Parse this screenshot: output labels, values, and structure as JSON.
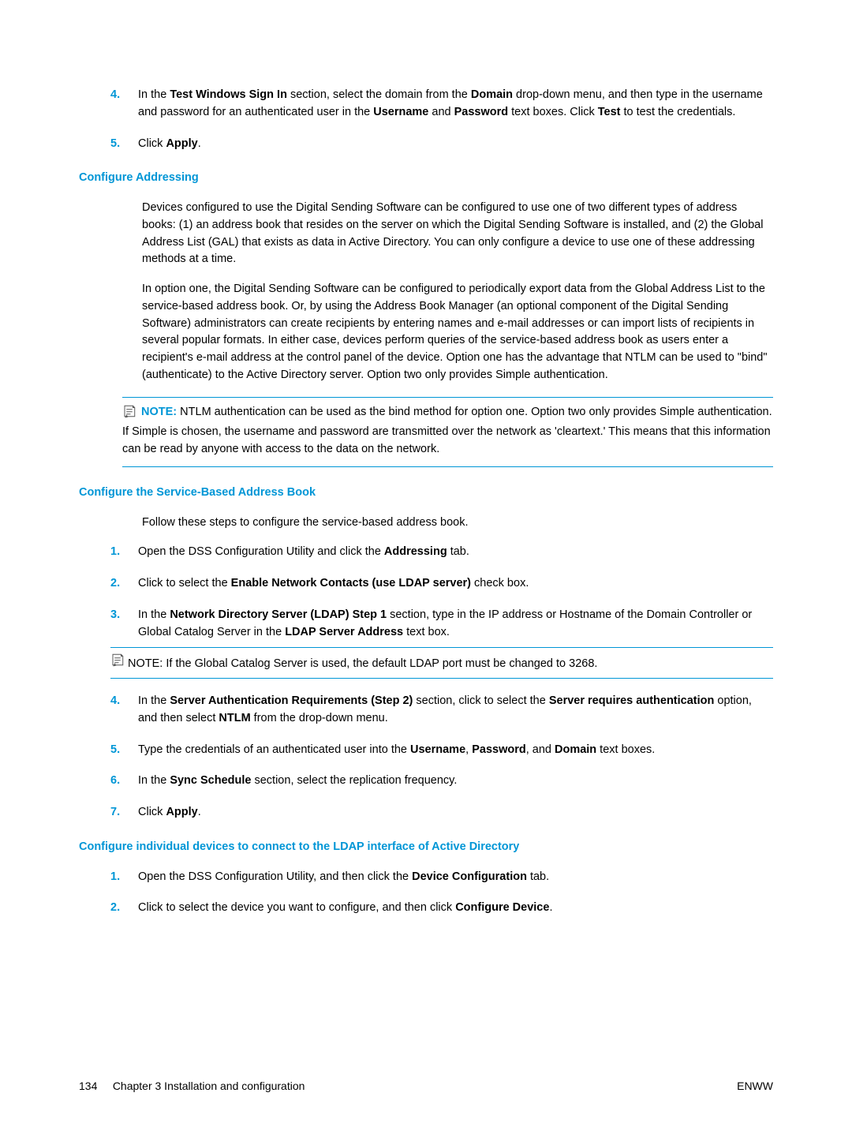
{
  "step4": {
    "num": "4.",
    "text_a": "In the ",
    "b1": "Test Windows Sign In",
    "text_b": " section, select the domain from the ",
    "b2": "Domain",
    "text_c": " drop-down menu, and then type in the username and password for an authenticated user in the ",
    "b3": "Username",
    "text_d": " and ",
    "b4": "Password",
    "text_e": " text boxes. Click ",
    "b5": "Test",
    "text_f": " to test the credentials."
  },
  "step5": {
    "num": "5.",
    "text_a": "Click ",
    "b1": "Apply",
    "text_b": "."
  },
  "h_addr": "Configure Addressing",
  "p_addr1": "Devices configured to use the Digital Sending Software can be configured to use one of two different types of address books: (1) an address book that resides on the server on which the Digital Sending Software is installed, and (2) the Global Address List (GAL) that exists as data in Active Directory. You can only configure a device to use one of these address­ing methods at a time.",
  "p_addr2": "In option one, the Digital Sending Software can be configured to periodically export data from the Global Address List to the service-based address book. Or, by using the Address Book Manager (an optional component of the Digital Sending Software) administrators can create recipients by entering names and e-mail addresses or can import lists of recipients in several popular formats. In either case, devices perform queries of the service-based address book as users enter a recipient's e-mail address at the control panel of the device. Option one has the advantage that NTLM can be used to \"bind\" (authenticate) to the Active Directory server. Option two only provides Simple authentication.",
  "note1": {
    "label": "NOTE:",
    "text": "NTLM authentication can be used as the bind method for option one. Option two only provides Simple authentication. If Simple is chosen, the username and password are transmitted over the network as 'cleartext.' This means that this information can be read by anyone with access to the data on the network."
  },
  "h_svc": "Configure the Service-Based Address Book",
  "p_svc_intro": "Follow these steps to configure the service-based address book.",
  "svc": {
    "s1": {
      "num": "1.",
      "a": "Open the DSS Configuration Utility and click the ",
      "b1": "Addressing",
      "b": " tab."
    },
    "s2": {
      "num": "2.",
      "a": "Click to select the ",
      "b1": "Enable Network Contacts (use LDAP server)",
      "b": " check box."
    },
    "s3": {
      "num": "3.",
      "a": "In the ",
      "b1": "Network Directory Server (LDAP) Step 1",
      "b": " section, type in the IP address or Hostname of the Domain Controller or Global Catalog Server in the ",
      "b2": "LDAP Server Address",
      "c": " text box."
    },
    "s3note": {
      "label": "NOTE:",
      "text": "If the Global Catalog Server is used, the default LDAP port must be changed to 3268."
    },
    "s4": {
      "num": "4.",
      "a": "In the ",
      "b1": "Server Authentication Requirements (Step 2)",
      "b": " section, click to select the ",
      "b2": "Server requires authentication",
      "c": " option, and then select ",
      "b3": "NTLM",
      "d": " from the drop-down menu."
    },
    "s5": {
      "num": "5.",
      "a": "Type the credentials of an authenticated user into the ",
      "b1": "Username",
      "b": ", ",
      "b2": "Password",
      "c": ", and ",
      "b3": "Domain",
      "d": " text boxes."
    },
    "s6": {
      "num": "6.",
      "a": "In the ",
      "b1": "Sync Schedule",
      "b": " section, select the replication frequency."
    },
    "s7": {
      "num": "7.",
      "a": "Click ",
      "b1": "Apply",
      "b": "."
    }
  },
  "h_ind": "Configure individual devices to connect to the LDAP interface of Active Directory",
  "ind": {
    "s1": {
      "num": "1.",
      "a": "Open the DSS Configuration Utility, and then click the ",
      "b1": "Device Configuration",
      "b": " tab."
    },
    "s2": {
      "num": "2.",
      "a": "Click to select the device you want to configure, and then click ",
      "b1": "Configure Device",
      "b": "."
    }
  },
  "footer": {
    "page": "134",
    "chapter": "Chapter 3   Installation and configuration",
    "right": "ENWW"
  }
}
